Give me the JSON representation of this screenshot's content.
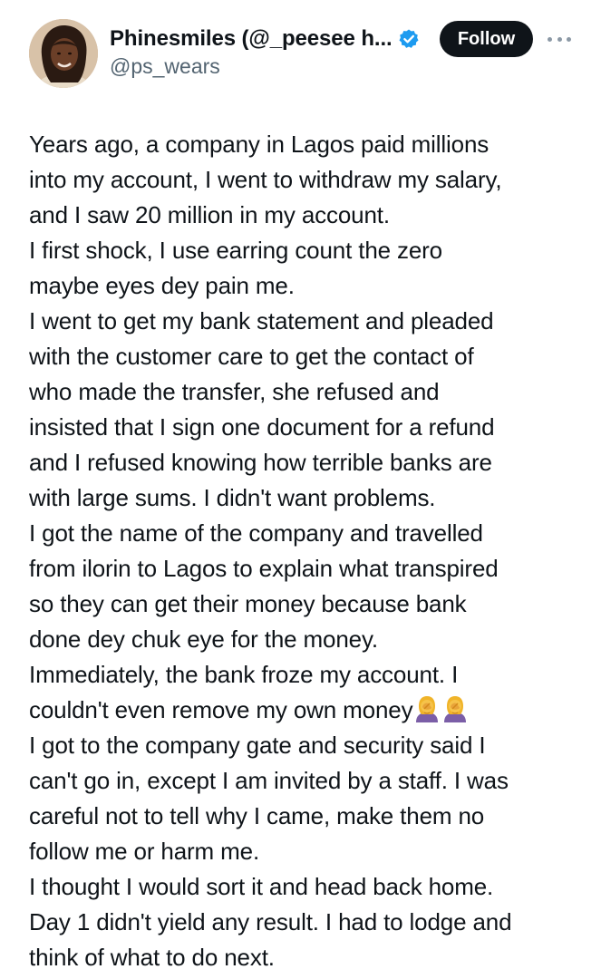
{
  "author": {
    "display_name": "Phinesmiles (@_peesee h...",
    "handle": "@ps_wears",
    "avatar_icon": "avatar-photo",
    "verified_icon": "verified-badge-icon",
    "verified_color": "#1d9bf0"
  },
  "actions": {
    "follow_label": "Follow",
    "more_icon": "more-options-icon"
  },
  "post": {
    "lines": [
      "Years ago, a company in Lagos paid millions",
      "into my account, I went to withdraw my salary,",
      "and I saw 20 million in my account.",
      "I first shock, I use earring count the zero",
      "maybe eyes dey pain me.",
      "I went to get my bank statement and pleaded",
      "with the customer care to get the contact of",
      "who made the transfer, she refused and",
      "insisted that I sign one document for a refund",
      "and I refused knowing how terrible banks are",
      "with large sums. I didn't want problems.",
      "I got the name of the company and travelled",
      "from ilorin to Lagos to explain what transpired",
      "so they can get their money because bank",
      "done dey chuk eye for the money.",
      "Immediately, the bank froze my account. I",
      "couldn't even remove my own money",
      "I got to the company gate and security said I",
      "can't go in, except I am invited by a staff. I was",
      "careful not to tell why I came, make them no",
      "follow me or harm me.",
      "I thought I would sort it and head back home.",
      "Day 1 didn't yield any result. I had to lodge and",
      "think of what to do next."
    ],
    "inline_emojis": [
      "person-facepalming-icon",
      "person-facepalming-icon"
    ]
  },
  "colors": {
    "text": "#0f1419",
    "secondary_text": "#536471",
    "button_bg": "#0f1419",
    "button_text": "#ffffff",
    "background": "#ffffff"
  }
}
